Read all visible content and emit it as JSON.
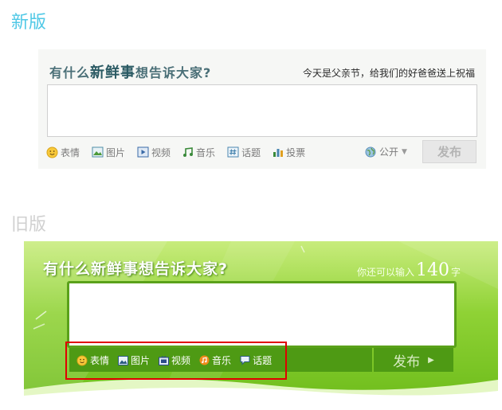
{
  "new_version": {
    "heading": "新版",
    "prompt_pre": "有什么",
    "prompt_accent": "新鲜事",
    "prompt_post": "想告诉大家?",
    "tip": "今天是父亲节，给我们的好爸爸送上祝福",
    "textarea_value": "",
    "tools": [
      {
        "icon": "smiley-icon",
        "label": "表情"
      },
      {
        "icon": "image-icon",
        "label": "图片"
      },
      {
        "icon": "video-icon",
        "label": "视频"
      },
      {
        "icon": "music-icon",
        "label": "音乐"
      },
      {
        "icon": "hashtag-icon",
        "label": "话题"
      },
      {
        "icon": "poll-icon",
        "label": "投票"
      }
    ],
    "visibility_label": "公开",
    "send_label": "发布"
  },
  "old_version": {
    "heading": "旧版",
    "prompt": "有什么新鲜事想告诉大家?",
    "counter_pre": "你还可以输入",
    "counter_value": "140",
    "counter_post": "字",
    "textarea_value": "",
    "tools": [
      {
        "icon": "smiley-icon",
        "label": "表情"
      },
      {
        "icon": "image-icon",
        "label": "图片"
      },
      {
        "icon": "video-icon",
        "label": "视频"
      },
      {
        "icon": "music-icon",
        "label": "音乐"
      },
      {
        "icon": "topic-icon",
        "label": "话题"
      }
    ],
    "send_label": "发布"
  },
  "colors": {
    "new_heading": "#4fc8e6",
    "old_heading": "#d0d0d0",
    "highlight_box": "#e00000",
    "old_background": "#8fd235"
  }
}
